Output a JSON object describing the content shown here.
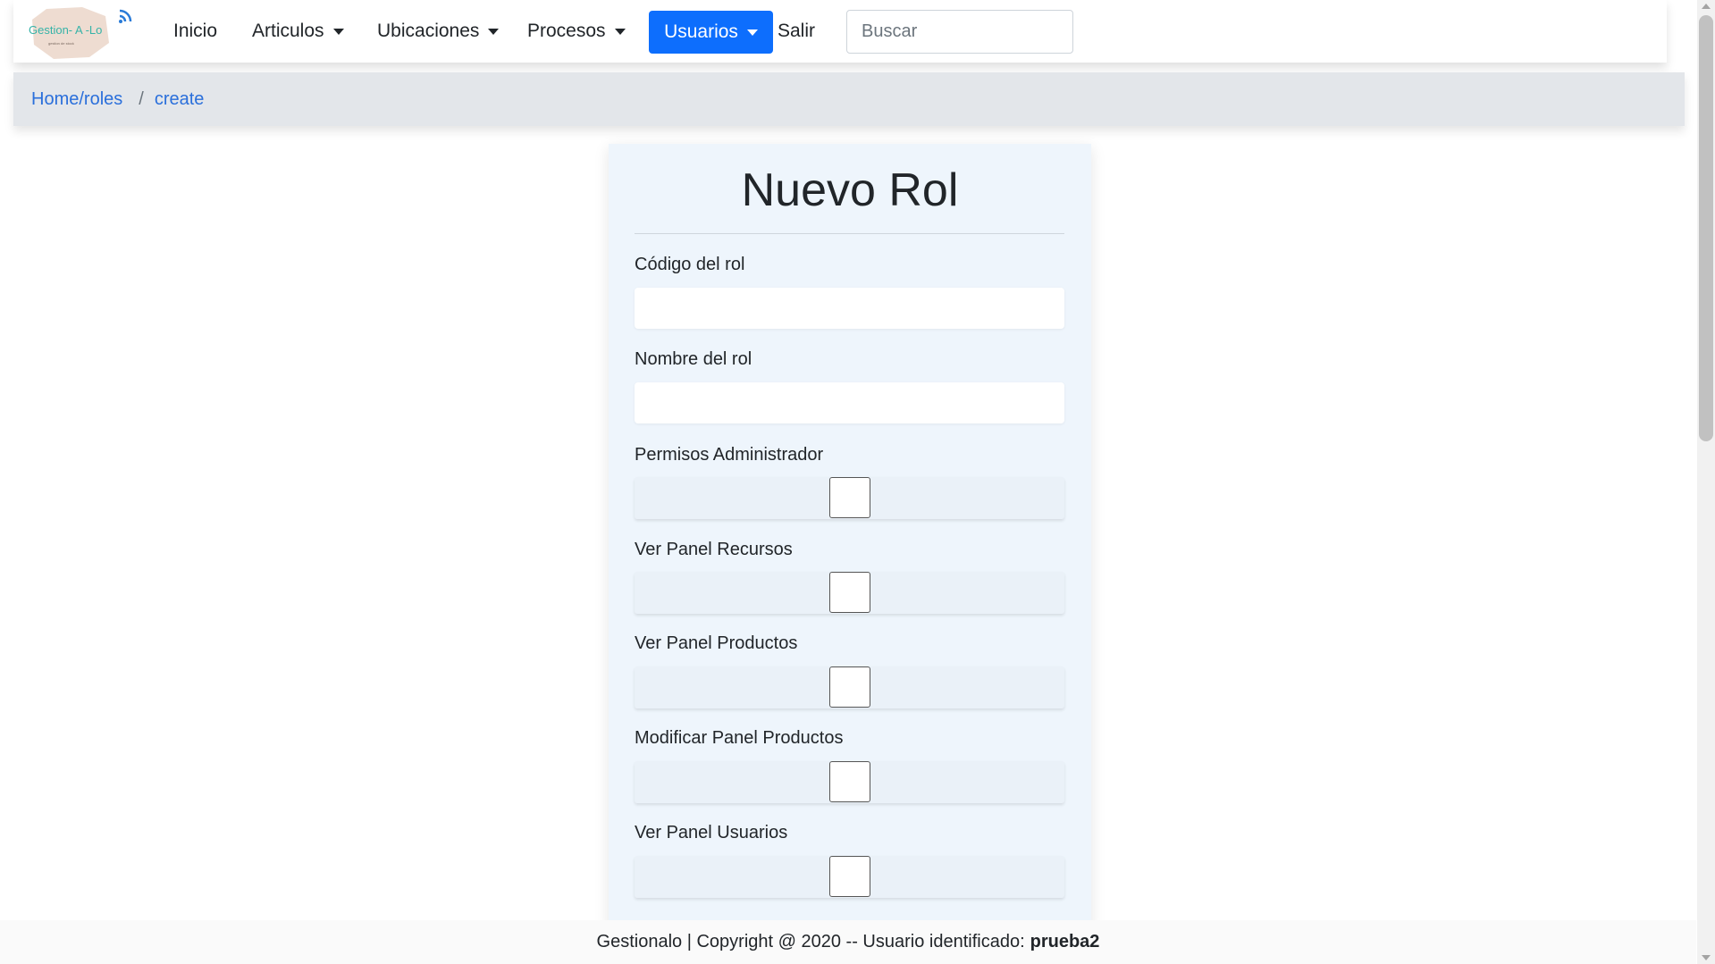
{
  "navbar": {
    "logo_text": "Gestion- A -Lo",
    "logo_subtext": "gestion de stock",
    "items": [
      {
        "label": "Inicio",
        "dropdown": false
      },
      {
        "label": "Articulos",
        "dropdown": true
      },
      {
        "label": "Ubicaciones",
        "dropdown": true
      },
      {
        "label": "Procesos",
        "dropdown": true
      },
      {
        "label": "Usuarios",
        "dropdown": true,
        "active": true
      },
      {
        "label": "Salir",
        "dropdown": false
      }
    ],
    "search_placeholder": "Buscar"
  },
  "breadcrumb": {
    "items": [
      "Home/roles",
      "create"
    ],
    "separator": "/"
  },
  "form": {
    "title": "Nuevo Rol",
    "fields": [
      {
        "label": "Código del rol",
        "type": "text",
        "value": ""
      },
      {
        "label": "Nombre del rol",
        "type": "text",
        "value": ""
      },
      {
        "label": "Permisos Administrador",
        "type": "checkbox",
        "checked": false
      },
      {
        "label": "Ver Panel Recursos",
        "type": "checkbox",
        "checked": false
      },
      {
        "label": "Ver Panel Productos",
        "type": "checkbox",
        "checked": false
      },
      {
        "label": "Modificar Panel Productos",
        "type": "checkbox",
        "checked": false
      },
      {
        "label": "Ver Panel Usuarios",
        "type": "checkbox",
        "checked": false
      }
    ]
  },
  "footer": {
    "text": "Gestionalo | Copyright @ 2020 -- Usuario identificado:",
    "user": "prueba2"
  },
  "colors": {
    "primary": "#0d6efd",
    "link": "#2a6fdb",
    "card_bg": "#eef5fc",
    "breadcrumb_bg": "#e3e6ea"
  }
}
